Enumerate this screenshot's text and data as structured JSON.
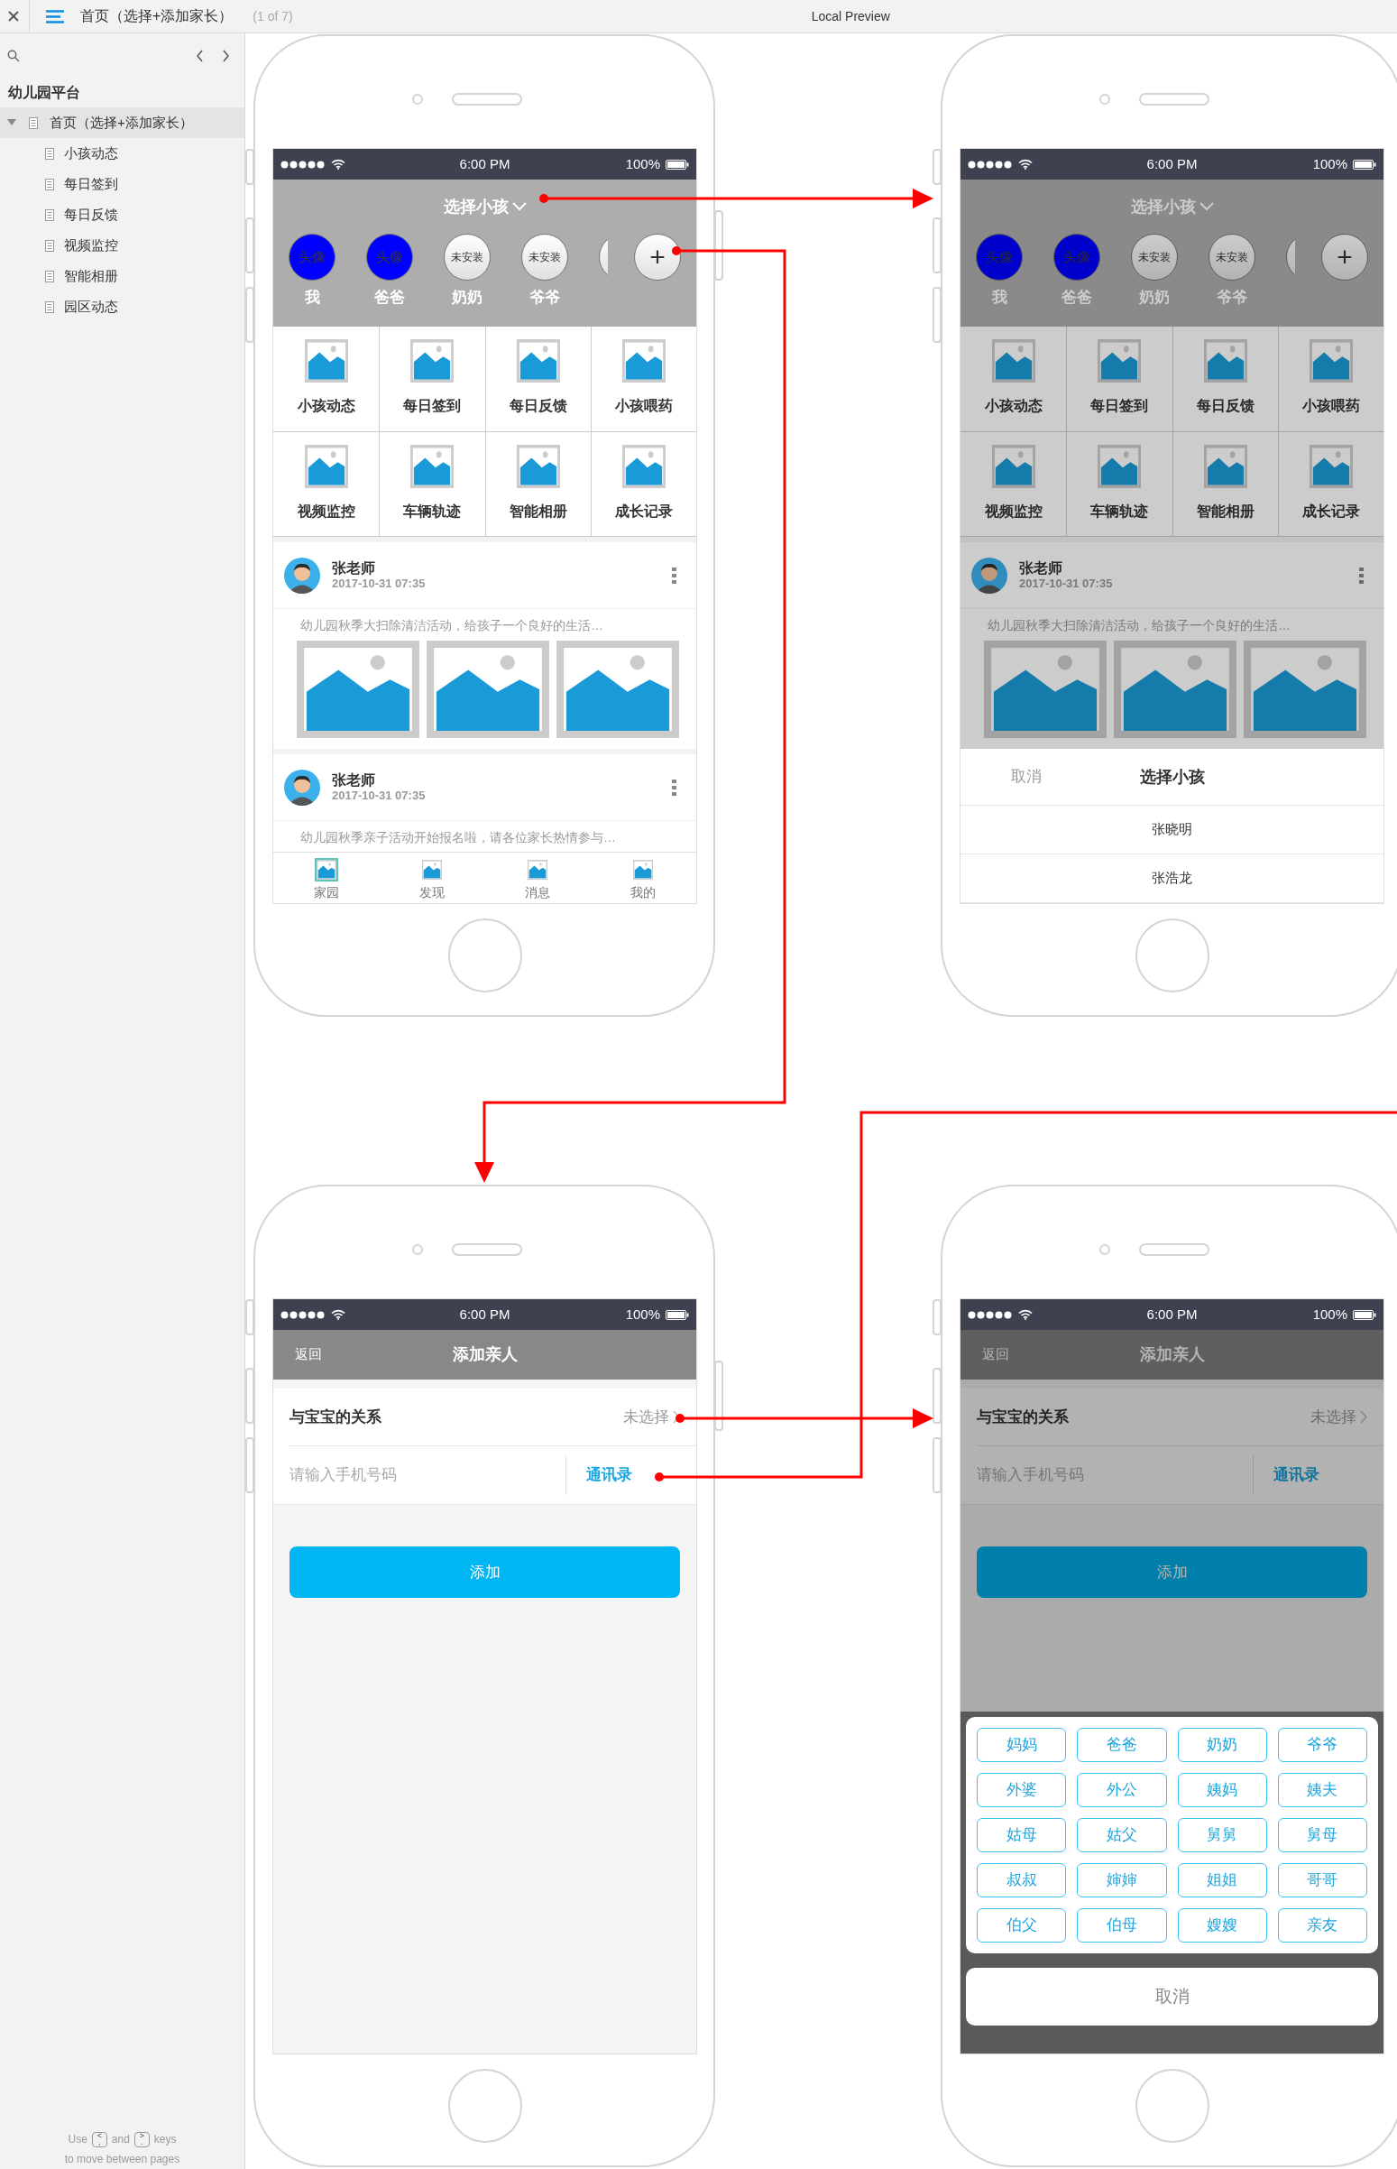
{
  "toolbar": {
    "page_title": "首页（选择+添加家长）",
    "page_count": "(1 of 7)",
    "preview_label": "Local Preview"
  },
  "sidebar": {
    "project": "幼儿园平台",
    "pages": [
      {
        "label": "首页（选择+添加家长）",
        "selected": true,
        "expanded": true,
        "children": [
          {
            "label": "小孩动态",
            "selected": false
          },
          {
            "label": "每日签到",
            "selected": false
          },
          {
            "label": "每日反馈",
            "selected": false
          },
          {
            "label": "视频监控",
            "selected": false
          },
          {
            "label": "智能相册",
            "selected": false
          },
          {
            "label": "园区动态",
            "selected": false
          }
        ]
      }
    ],
    "hint": {
      "before": "Use",
      "key_prev": [
        "<",
        ","
      ],
      "between": "and",
      "key_next": [
        ">",
        "."
      ],
      "after": "keys",
      "line2": "to move between pages"
    }
  },
  "screens": [
    {
      "kind": "home",
      "dimmed": false,
      "status": {
        "time": "6:00 PM",
        "battery": "100%"
      },
      "title": "选择小孩",
      "children": [
        {
          "kind": "set",
          "avatar_text": "头像",
          "name": "我"
        },
        {
          "kind": "set",
          "avatar_text": "头像",
          "name": "爸爸"
        },
        {
          "kind": "unset",
          "avatar_text": "未安装",
          "name": "奶奶"
        },
        {
          "kind": "unset",
          "avatar_text": "未安装",
          "name": "爷爷"
        },
        {
          "kind": "partial"
        }
      ],
      "add_label": "+",
      "features": [
        "小孩动态",
        "每日签到",
        "每日反馈",
        "小孩喂药",
        "视频监控",
        "车辆轨迹",
        "智能相册",
        "成长记录"
      ],
      "posts": [
        {
          "author": "张老师",
          "time": "2017-10-31 07:35",
          "text": "幼儿园秋季大扫除清洁活动，给孩子一个良好的生活…",
          "has_images": true
        },
        {
          "author": "张老师",
          "time": "2017-10-31 07:35",
          "text": "幼儿园秋季亲子活动开始报名啦，请各位家长热情参与…",
          "has_images": false
        }
      ],
      "tabs": [
        {
          "label": "家园",
          "selected": true
        },
        {
          "label": "发现",
          "selected": false
        },
        {
          "label": "消息",
          "selected": false
        },
        {
          "label": "我的",
          "selected": false
        }
      ]
    },
    {
      "kind": "home",
      "dimmed": true,
      "status": {
        "time": "6:00 PM",
        "battery": "100%"
      },
      "title": "选择小孩",
      "children": [
        {
          "kind": "set",
          "avatar_text": "头像",
          "name": "我"
        },
        {
          "kind": "set",
          "avatar_text": "头像",
          "name": "爸爸"
        },
        {
          "kind": "unset",
          "avatar_text": "未安装",
          "name": "奶奶"
        },
        {
          "kind": "unset",
          "avatar_text": "未安装",
          "name": "爷爷"
        },
        {
          "kind": "partial"
        }
      ],
      "add_label": "+",
      "features": [
        "小孩动态",
        "每日签到",
        "每日反馈",
        "小孩喂药",
        "视频监控",
        "车辆轨迹",
        "智能相册",
        "成长记录"
      ],
      "posts": [
        {
          "author": "张老师",
          "time": "2017-10-31 07:35",
          "text": "幼儿园秋季大扫除清洁活动，给孩子一个良好的生活…",
          "has_images": true
        }
      ],
      "sheet": {
        "cancel": "取消",
        "title": "选择小孩",
        "options": [
          "张晓明",
          "张浩龙"
        ]
      }
    },
    {
      "kind": "add",
      "dimmed": false,
      "status": {
        "time": "6:00 PM",
        "battery": "100%"
      },
      "back": "返回",
      "title": "添加亲人",
      "relation_label": "与宝宝的关系",
      "relation_value": "未选择",
      "phone_placeholder": "请输入手机号码",
      "contacts": "通讯录",
      "submit": "添加"
    },
    {
      "kind": "add",
      "dimmed": true,
      "status": {
        "time": "6:00 PM",
        "battery": "100%"
      },
      "back": "返回",
      "title": "添加亲人",
      "relation_label": "与宝宝的关系",
      "relation_value": "未选择",
      "phone_placeholder": "请输入手机号码",
      "contacts": "通讯录",
      "submit": "添加",
      "picker": {
        "options": [
          "妈妈",
          "爸爸",
          "奶奶",
          "爷爷",
          "外婆",
          "外公",
          "姨妈",
          "姨夫",
          "姑母",
          "姑父",
          "舅舅",
          "舅母",
          "叔叔",
          "婶婶",
          "姐姐",
          "哥哥",
          "伯父",
          "伯母",
          "嫂嫂",
          "亲友"
        ],
        "cancel": "取消"
      }
    }
  ]
}
